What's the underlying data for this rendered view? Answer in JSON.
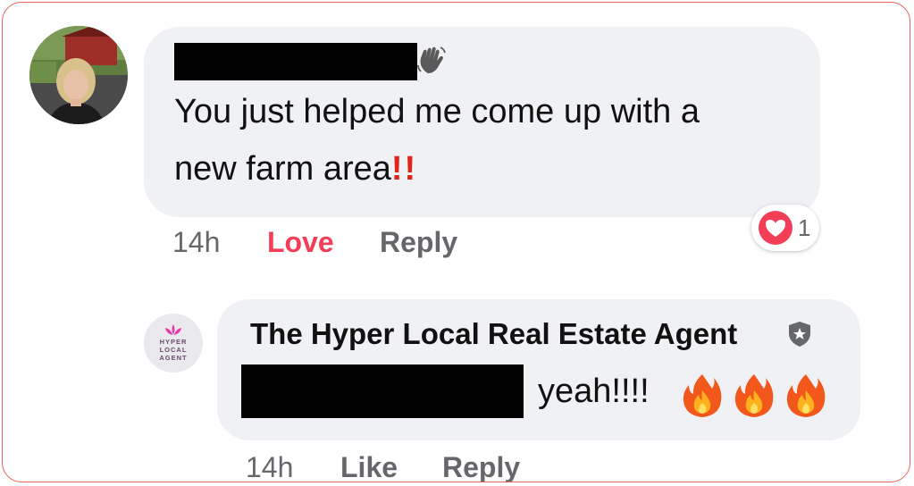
{
  "comment_1": {
    "text_line_1": "You just helped me come up with a",
    "text_line_2": "new farm area",
    "emphasis": "!!",
    "timestamp": "14h",
    "love_label": "Love",
    "reply_label": "Reply",
    "reaction": {
      "icon": "heart-icon",
      "count": "1",
      "color": "#f33e58"
    }
  },
  "comment_2": {
    "author": "The Hyper Local Real Estate Agent",
    "avatar_text": [
      "HYPER",
      "LOCAL",
      "AGENT"
    ],
    "text": "yeah!!!!",
    "timestamp": "14h",
    "like_label": "Like",
    "reply_label": "Reply"
  },
  "colors": {
    "bubble": "#f0f1f4",
    "action_text": "#65676b",
    "love": "#f33e58",
    "border": "#e8625a"
  }
}
